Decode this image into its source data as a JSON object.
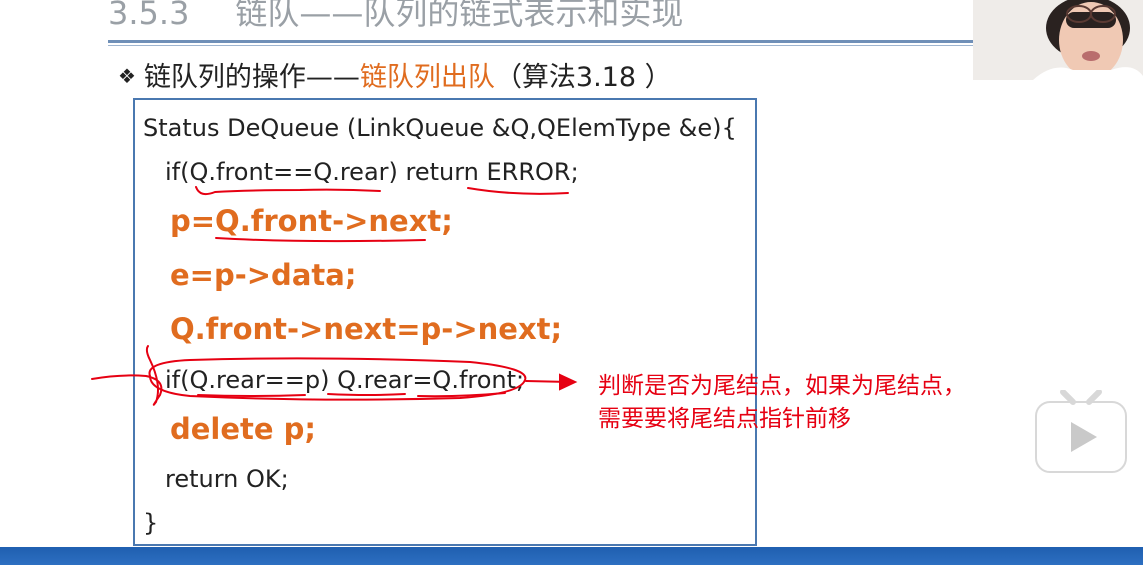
{
  "slide": {
    "section_number": "3.5.3",
    "section_title": "链队——队列的链式表示和实现",
    "bullet_prefix": "链队列的操作——",
    "bullet_accent": "链队列出队",
    "bullet_suffix": "（算法3.18 ）"
  },
  "code_lines": [
    "Status DeQueue (LinkQueue &Q,QElemType &e){",
    "if(Q.front==Q.rear) return ERROR;",
    "p=Q.front->next;",
    "e=p->data;",
    "Q.front->next=p->next;",
    "if(Q.rear==p) Q.rear=Q.front;",
    "delete p;",
    "return OK;",
    "}"
  ],
  "annotation": {
    "line1": "判断是否为尾结点，如果为尾结点，",
    "line2": "需要要将尾结点指针前移"
  },
  "colors": {
    "accent": "#e06c1f",
    "annotation": "#e60012",
    "border": "#4a78b0",
    "bottom_bar": "#1f5fb0"
  },
  "icons": [
    "diamond-bullet-icon",
    "play-icon"
  ]
}
